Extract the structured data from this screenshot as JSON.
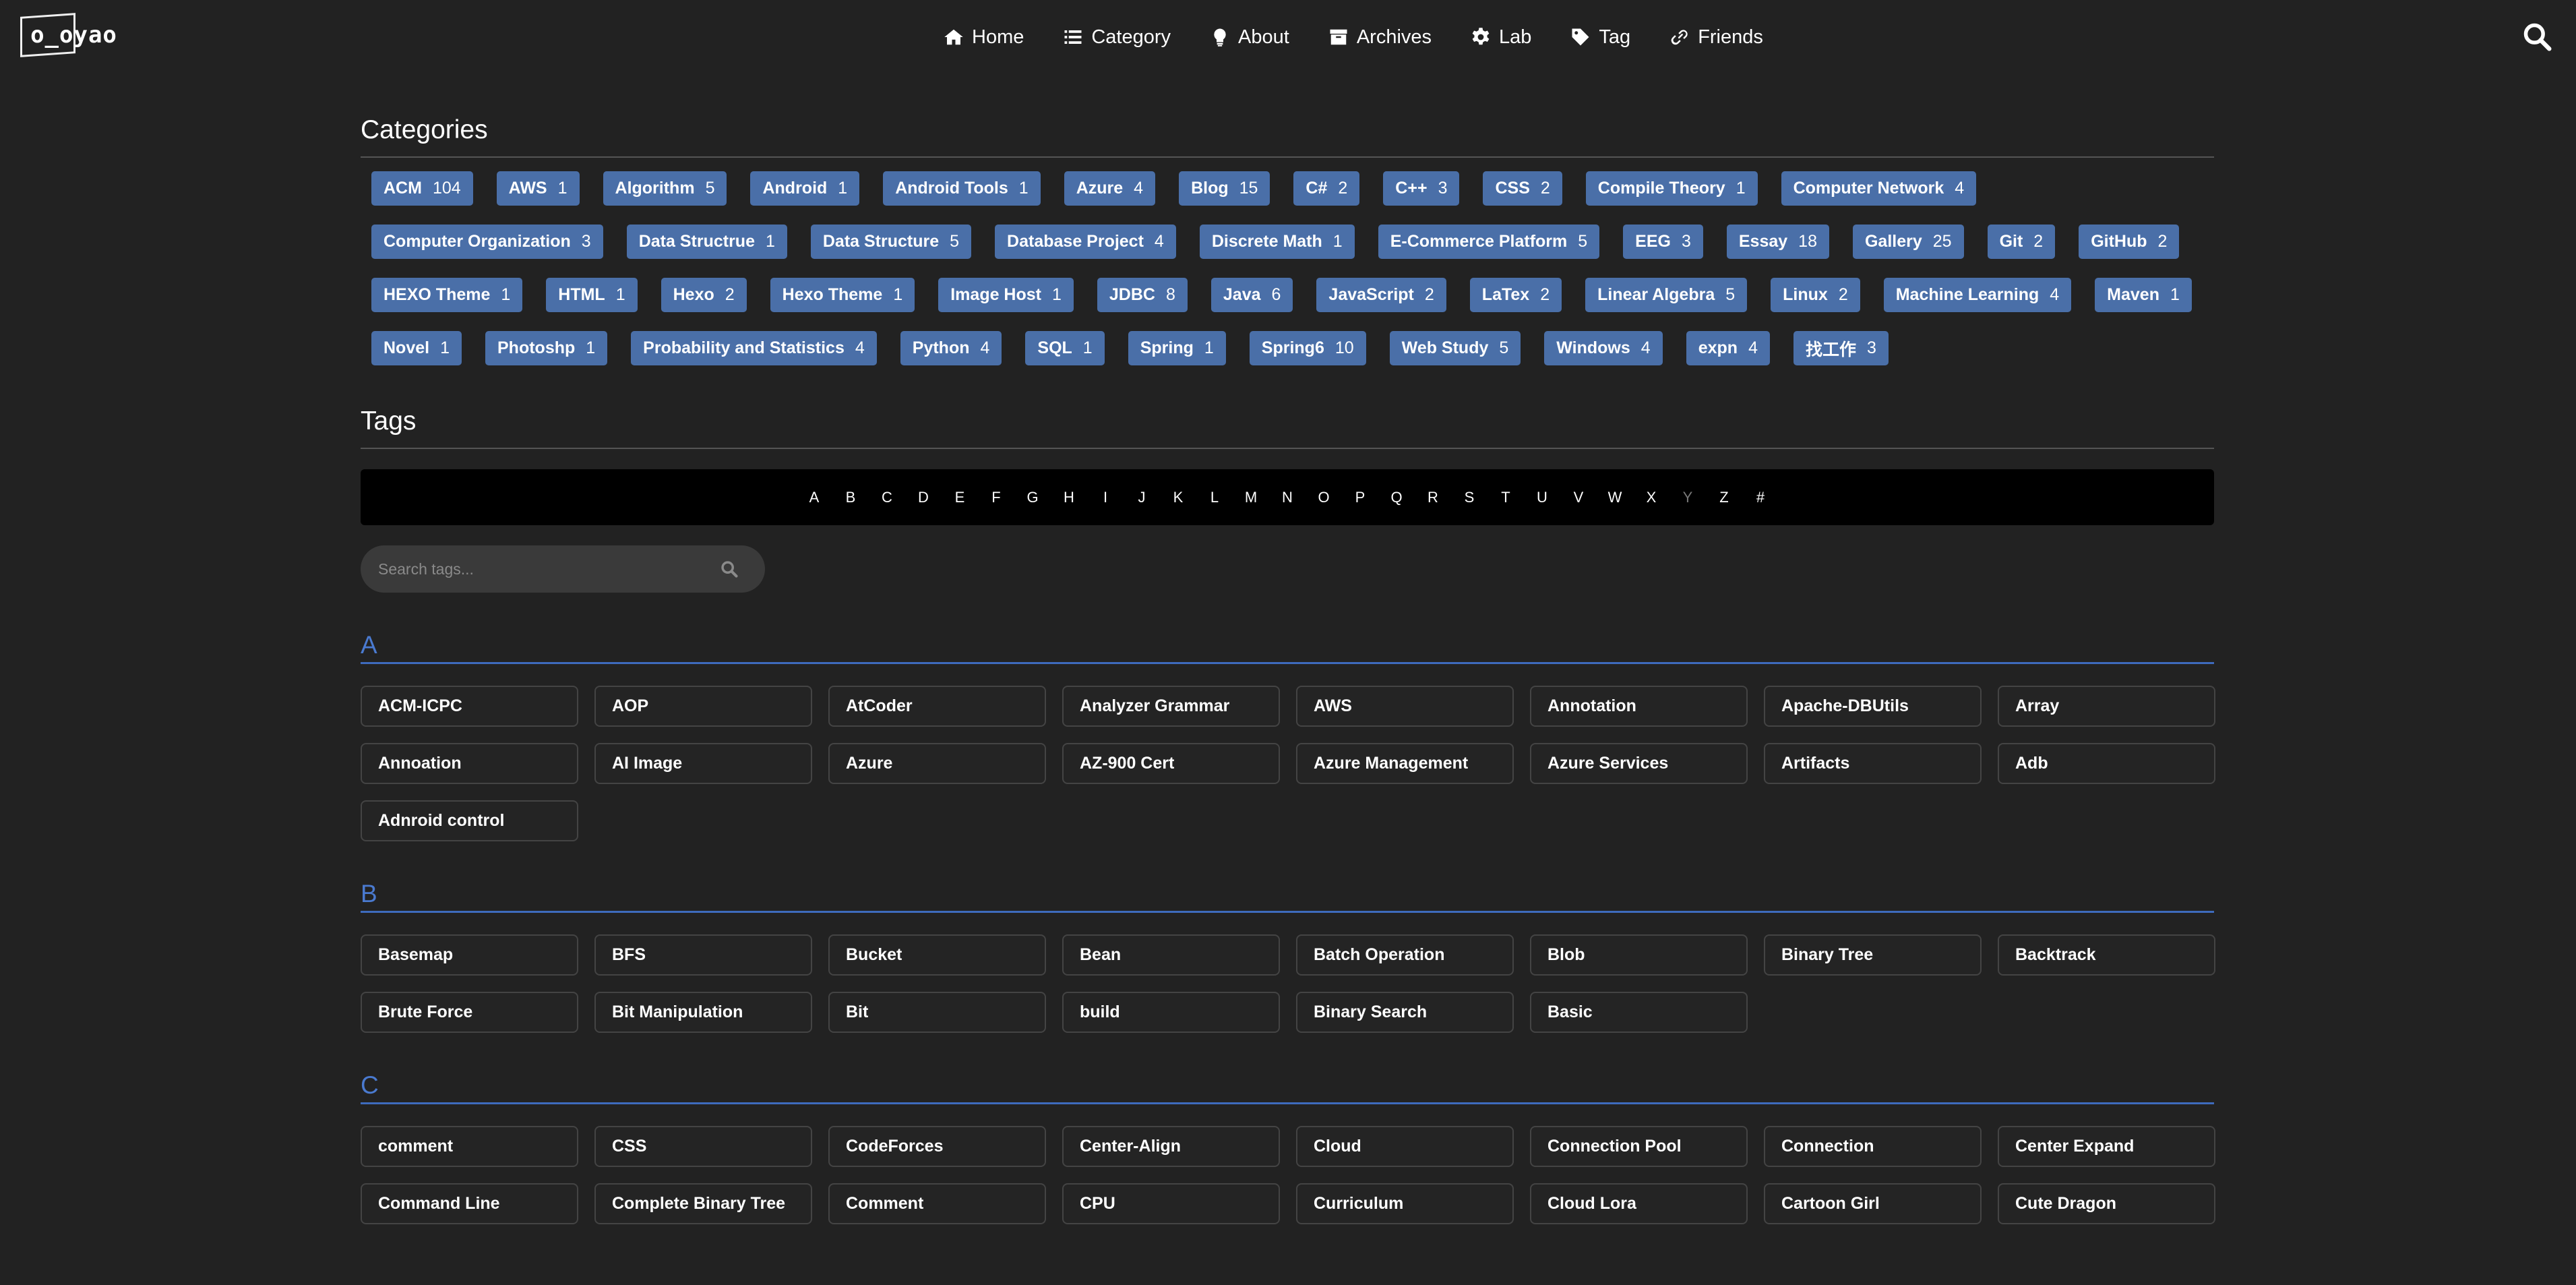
{
  "logo": {
    "text": "o_oyao"
  },
  "nav": [
    {
      "label": "Home",
      "icon": "home-icon"
    },
    {
      "label": "Category",
      "icon": "list-icon"
    },
    {
      "label": "About",
      "icon": "lightbulb-icon"
    },
    {
      "label": "Archives",
      "icon": "archive-icon"
    },
    {
      "label": "Lab",
      "icon": "gear-icon"
    },
    {
      "label": "Tag",
      "icon": "tag-icon"
    },
    {
      "label": "Friends",
      "icon": "link-icon"
    }
  ],
  "categories": {
    "title": "Categories",
    "items": [
      {
        "name": "ACM",
        "count": "104"
      },
      {
        "name": "AWS",
        "count": "1"
      },
      {
        "name": "Algorithm",
        "count": "5"
      },
      {
        "name": "Android",
        "count": "1"
      },
      {
        "name": "Android Tools",
        "count": "1"
      },
      {
        "name": "Azure",
        "count": "4"
      },
      {
        "name": "Blog",
        "count": "15"
      },
      {
        "name": "C#",
        "count": "2"
      },
      {
        "name": "C++",
        "count": "3"
      },
      {
        "name": "CSS",
        "count": "2"
      },
      {
        "name": "Compile Theory",
        "count": "1"
      },
      {
        "name": "Computer Network",
        "count": "4"
      },
      {
        "name": "Computer Organization",
        "count": "3"
      },
      {
        "name": "Data Structrue",
        "count": "1"
      },
      {
        "name": "Data Structure",
        "count": "5"
      },
      {
        "name": "Database Project",
        "count": "4"
      },
      {
        "name": "Discrete Math",
        "count": "1"
      },
      {
        "name": "E-Commerce Platform",
        "count": "5"
      },
      {
        "name": "EEG",
        "count": "3"
      },
      {
        "name": "Essay",
        "count": "18"
      },
      {
        "name": "Gallery",
        "count": "25"
      },
      {
        "name": "Git",
        "count": "2"
      },
      {
        "name": "GitHub",
        "count": "2"
      },
      {
        "name": "HEXO Theme",
        "count": "1"
      },
      {
        "name": "HTML",
        "count": "1"
      },
      {
        "name": "Hexo",
        "count": "2"
      },
      {
        "name": "Hexo Theme",
        "count": "1"
      },
      {
        "name": "Image Host",
        "count": "1"
      },
      {
        "name": "JDBC",
        "count": "8"
      },
      {
        "name": "Java",
        "count": "6"
      },
      {
        "name": "JavaScript",
        "count": "2"
      },
      {
        "name": "LaTex",
        "count": "2"
      },
      {
        "name": "Linear Algebra",
        "count": "5"
      },
      {
        "name": "Linux",
        "count": "2"
      },
      {
        "name": "Machine Learning",
        "count": "4"
      },
      {
        "name": "Maven",
        "count": "1"
      },
      {
        "name": "Novel",
        "count": "1"
      },
      {
        "name": "Photoshp",
        "count": "1"
      },
      {
        "name": "Probability and Statistics",
        "count": "4"
      },
      {
        "name": "Python",
        "count": "4"
      },
      {
        "name": "SQL",
        "count": "1"
      },
      {
        "name": "Spring",
        "count": "1"
      },
      {
        "name": "Spring6",
        "count": "10"
      },
      {
        "name": "Web Study",
        "count": "5"
      },
      {
        "name": "Windows",
        "count": "4"
      },
      {
        "name": "expn",
        "count": "4"
      },
      {
        "name": "找工作",
        "count": "3"
      }
    ]
  },
  "tags": {
    "title": "Tags",
    "alphabet": [
      "A",
      "B",
      "C",
      "D",
      "E",
      "F",
      "G",
      "H",
      "I",
      "J",
      "K",
      "L",
      "M",
      "N",
      "O",
      "P",
      "Q",
      "R",
      "S",
      "T",
      "U",
      "V",
      "W",
      "X",
      "Y",
      "Z",
      "#"
    ],
    "dim_letters": [
      "Y"
    ],
    "search_placeholder": "Search tags...",
    "groups": [
      {
        "letter": "A",
        "items": [
          "ACM-ICPC",
          "AOP",
          "AtCoder",
          "Analyzer Grammar",
          "AWS",
          "Annotation",
          "Apache-DBUtils",
          "Array",
          "Annoation",
          "AI Image",
          "Azure",
          "AZ-900 Cert",
          "Azure Management",
          "Azure Services",
          "Artifacts",
          "Adb",
          "Adnroid control"
        ]
      },
      {
        "letter": "B",
        "items": [
          "Basemap",
          "BFS",
          "Bucket",
          "Bean",
          "Batch Operation",
          "Blob",
          "Binary Tree",
          "Backtrack",
          "Brute Force",
          "Bit Manipulation",
          "Bit",
          "build",
          "Binary Search",
          "Basic"
        ]
      },
      {
        "letter": "C",
        "items": [
          "comment",
          "CSS",
          "CodeForces",
          "Center-Align",
          "Cloud",
          "Connection Pool",
          "Connection",
          "Center Expand",
          "Command Line",
          "Complete Binary Tree",
          "Comment",
          "CPU",
          "Curriculum",
          "Cloud Lora",
          "Cartoon Girl",
          "Cute Dragon"
        ]
      }
    ]
  }
}
